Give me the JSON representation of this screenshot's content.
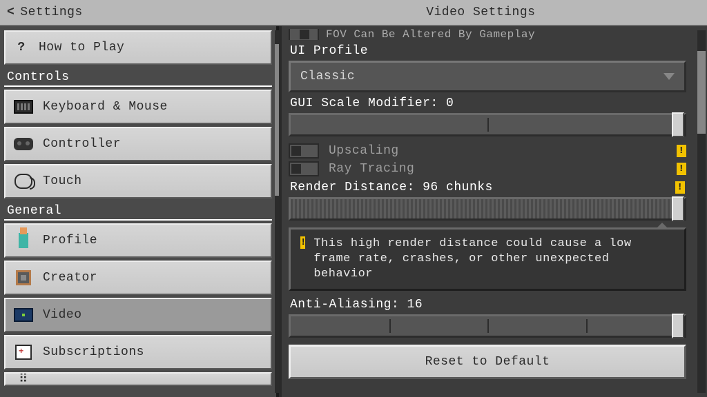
{
  "header": {
    "back_label": "Settings",
    "title": "Video Settings"
  },
  "sidebar": {
    "how_to_play": "How to Play",
    "section_controls": "Controls",
    "keyboard": "Keyboard & Mouse",
    "controller": "Controller",
    "touch": "Touch",
    "section_general": "General",
    "profile": "Profile",
    "creator": "Creator",
    "video": "Video",
    "subscriptions": "Subscriptions"
  },
  "panel": {
    "partial_top": "FOV Can Be Altered By Gameplay",
    "ui_profile_label": "UI Profile",
    "ui_profile_value": "Classic",
    "gui_scale_label": "GUI Scale Modifier: 0",
    "upscaling": "Upscaling",
    "ray_tracing": "Ray Tracing",
    "render_distance_label": "Render Distance: 96 chunks",
    "callout": "This high render distance could cause a low frame rate, crashes, or other unexpected behavior",
    "antialias_label": "Anti-Aliasing: 16",
    "reset": "Reset to Default"
  },
  "sliders": {
    "gui_scale": {
      "value": 1.0,
      "ticks": [
        0.5
      ]
    },
    "render_distance": {
      "value": 1.0,
      "ticks": []
    },
    "antialias": {
      "value": 1.0,
      "ticks": [
        0.25,
        0.5,
        0.75
      ]
    }
  }
}
